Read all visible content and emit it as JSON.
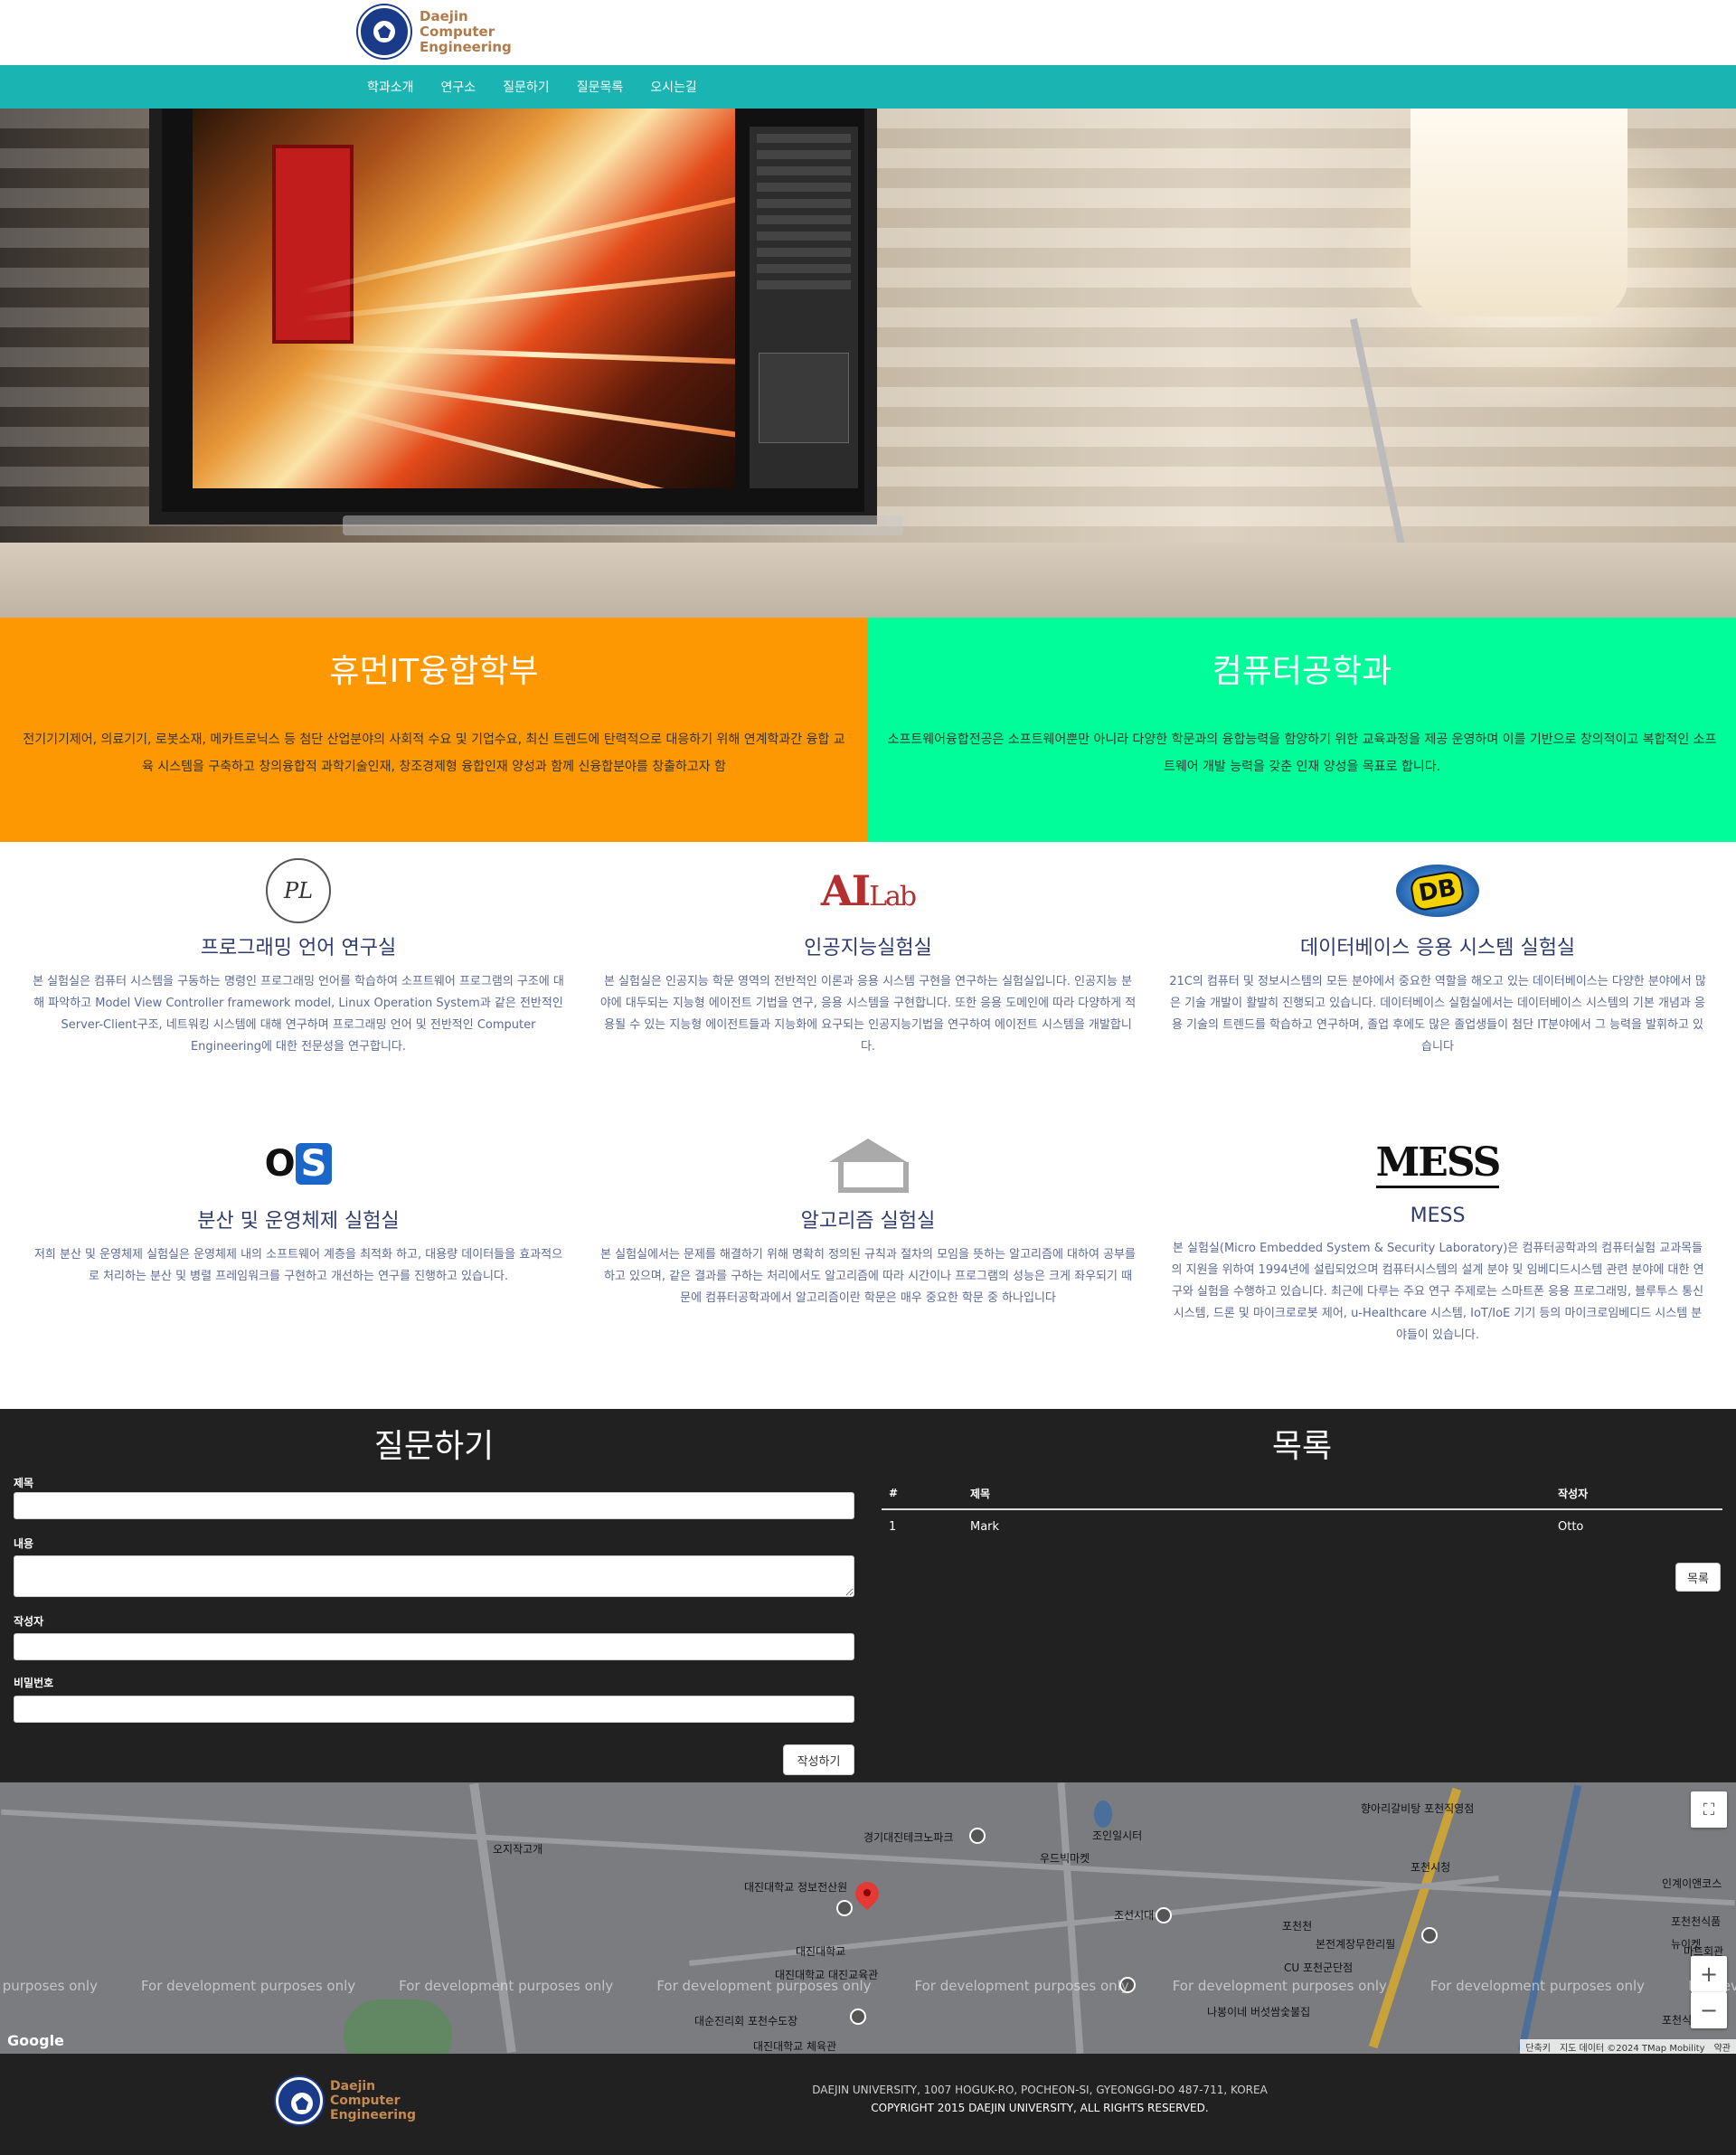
{
  "brand": {
    "line1": "Daejin",
    "line2": "Computer",
    "line3": "Engineering"
  },
  "nav": [
    "학과소개",
    "연구소",
    "질문하기",
    "질문목록",
    "오시는길"
  ],
  "departments": [
    {
      "title": "휴먼IT융합학부",
      "desc": "전기기기제어, 의료기기, 로봇소재, 메카트로닉스 등 첨단 산업분야의 사회적 수요 및 기업수요, 최신 트렌드에 탄력적으로 대응하기 위해 연계학과간 융합 교육 시스템을 구축하고 창의융합적 과학기술인재, 창조경제형 융합인재 양성과 함께 신융합분야를 창출하고자 함",
      "color": "#fd9802"
    },
    {
      "title": "컴퓨터공학과",
      "desc": "소프트웨어융합전공은 소프트웨어뿐만 아니라 다양한 학문과의 융합능력을 함양하기 위한 교육과정을 제공 운영하며 이를 기반으로 창의적이고 복합적인 소프트웨어 개발 능력을 갖춘 인재 양성을 목표로 합니다.",
      "color": "#00fd99"
    }
  ],
  "labs": [
    {
      "title": "프로그래밍 언어 연구실",
      "desc": "본 실험실은 컴퓨터 시스템을 구동하는 명령인 프로그래밍 언어를 학습하여 소프트웨어 프로그램의 구조에 대해 파악하고 Model View Controller framework model, Linux Operation System과 같은 전반적인 Server-Client구조, 네트워킹 시스템에 대해 연구하며 프로그래밍 언어 및 전반적인 Computer Engineering에 대한 전문성을 연구합니다.",
      "logo_text": "PL"
    },
    {
      "title": "인공지능실험실",
      "desc": "본 실험실은 인공지능 학문 영역의 전반적인 이론과 응용 시스템 구현을 연구하는 실험실입니다. 인공지능 분야에 대두되는 지능형 에이전트 기법을 연구, 응용 시스템을 구현합니다. 또한 응용 도메인에 따라 다양하게 적용될 수 있는 지능형 에이전트들과 지능화에 요구되는 인공지능기법을 연구하여 에이전트 시스템을 개발합니다.",
      "logo_text": "AI",
      "logo_sub": "Lab"
    },
    {
      "title": "데이터베이스 응용 시스템 실험실",
      "desc": "21C의 컴퓨터 및 정보시스템의 모든 분야에서 중요한 역할을 해오고 있는 데이터베이스는 다양한 분야에서 많은 기술 개발이 활발히 진행되고 있습니다. 데이터베이스 실험실에서는 데이터베이스 시스템의 기본 개념과 응용 기술의 트렌드를 학습하고 연구하며, 졸업 후에도 많은 졸업생들이 첨단 IT분야에서 그 능력을 발휘하고 있습니다",
      "logo_text": "DB"
    },
    {
      "title": "분산 및 운영체제 실험실",
      "desc": "저희 분산 및 운영체제 실험실은 운영체제 내의 소프트웨어 계층을 최적화 하고, 대용량 데이터들을 효과적으로 처리하는 분산 및 병렬 프레임워크를 구현하고 개선하는 연구를 진행하고 있습니다.",
      "logo_text": "O",
      "logo_text2": "S"
    },
    {
      "title": "알고리즘 실험실",
      "desc": "본 실험실에서는 문제를 해결하기 위해 명확히 정의된 규칙과 절차의 모임을 뜻하는 알고리즘에 대하여 공부를 하고 있으며, 같은 결과를 구하는 처리에서도 알고리즘에 따라 시간이나 프로그램의 성능은 크게 좌우되기 때문에 컴퓨터공학과에서 알고리즘이란 학문은 매우 중요한 학문 중 하나입니다"
    },
    {
      "title": "MESS",
      "desc": "본 실험실(Micro Embedded System & Security Laboratory)은 컴퓨터공학과의 컴퓨터실험 교과목들의 지원을 위하여 1994년에 설립되었으며 컴퓨터시스템의 설계 분야 및 임베디드시스템 관련 분야에 대한 연구와 실험을 수행하고 있습니다. 최근에 다루는 주요 연구 주제로는 스마트폰 응용 프로그래밍, 블루투스 통신 시스템, 드론 및 마이크로로봇 제어, u-Healthcare 시스템, IoT/IoE 기기 등의 마이크로임베디드 시스템 분야들이 있습니다.",
      "logo_text": "MESS"
    }
  ],
  "ask": {
    "title": "질문하기",
    "fields": [
      {
        "label": "제목",
        "value": ""
      },
      {
        "label": "내용",
        "value": ""
      },
      {
        "label": "작성자",
        "value": ""
      },
      {
        "label": "비밀번호",
        "value": ""
      }
    ],
    "submit": "작성하기"
  },
  "list": {
    "title": "목록",
    "columns": [
      "#",
      "제목",
      "작성자"
    ],
    "rows": [
      [
        "1",
        "Mark",
        "Otto"
      ]
    ],
    "button": "목록"
  },
  "map": {
    "dev_text": "For development purposes only",
    "dev_text_first": "opment purposes only",
    "labels": [
      "오지작고개",
      "경기대진테크노파크",
      "대진대학교 정보전산원",
      "대진대학교",
      "대진대학교 대진교육관",
      "대순진리회 포천수도장",
      "대진대학교 체육관",
      "우드빅마켓",
      "조선시대",
      "포천시청",
      "포천천",
      "향아리갈비탕 포천직영점",
      "본전계장무한리필",
      "CU 포천군단점",
      "나봉이네 버섯쌈숯불집",
      "인계이앤코스",
      "포천천식품",
      "뉴이켓",
      "마트회관",
      "포천식당",
      "조인일시터"
    ],
    "google": "Google",
    "attrib": [
      "단축키",
      "지도 데이터 ©2024 TMap Mobility",
      "약관"
    ]
  },
  "footer": {
    "address": "DAEJIN UNIVERSITY, 1007 HOGUK-RO, POCHEON-SI, GYEONGGI-DO 487-711, KOREA",
    "copyright": "COPYRIGHT 2015 DAEJIN UNIVERSITY, ALL RIGHTS RESERVED."
  }
}
